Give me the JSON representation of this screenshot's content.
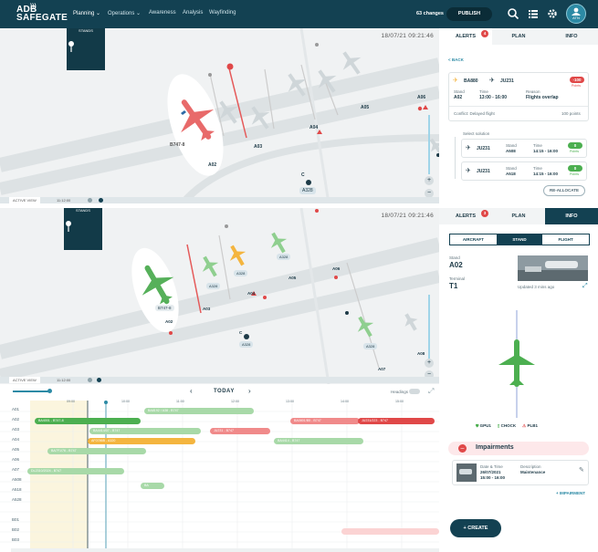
{
  "topbar": {
    "logo_line1": "ADB",
    "logo_line2": "SAFEGATE",
    "nav": [
      "Planning",
      "Operations",
      "Awareness",
      "Analysis",
      "Wayfinding"
    ],
    "changes": "63 changes",
    "publish": "PUBLISH",
    "user_initials": "ATN"
  },
  "map_top": {
    "timestamp": "18/07/21  09:21:46",
    "stands_label": "STANDS",
    "strip_label": "ACTIVE VIEW",
    "strip_time": "11:12:00",
    "labels": {
      "aircraft": "B747-8",
      "a02": "A02",
      "a03": "A03",
      "a04": "A04",
      "a05": "A05",
      "a06": "A06",
      "c": "C",
      "a328": "A328"
    }
  },
  "map_bottom": {
    "timestamp": "18/07/21  09:21:46",
    "stands_label": "STANDS",
    "strip_label": "ACTIVE VIEW",
    "strip_time": "11:12:00",
    "labels": {
      "aircraft": "B747-8",
      "a02": "A02",
      "a03": "A03",
      "a04": "A04",
      "a05": "A05",
      "a06": "A06",
      "a07": "A07",
      "a08": "A08",
      "c": "C",
      "a328_1": "A328",
      "a328_2": "A328",
      "a328_3": "A328",
      "a328_4": "A328",
      "a328_5": "A328"
    }
  },
  "timeline": {
    "today": "TODAY",
    "headings": "Headings",
    "rows": [
      "A01",
      "A02",
      "A03",
      "A04",
      "A05",
      "A06",
      "A07",
      "A508",
      "A518",
      "A528",
      "",
      "B01",
      "B02",
      "B03"
    ],
    "times": [
      "09:00",
      "10:00",
      "11:00",
      "12:00",
      "13:00",
      "14:00",
      "15:00",
      "16:00"
    ],
    "bars": [
      {
        "label": "BA8192 / A38 - B747",
        "color": "#8fcf8f"
      },
      {
        "label": "BA4001 - B747-8",
        "color": "#4caf50"
      },
      {
        "label": "BA0801/B5 - B747",
        "color": "#f08a8a"
      },
      {
        "label": "JU231/223 - B747",
        "color": "#e04848"
      },
      {
        "label": "BA4414/07 - B747",
        "color": "#8fcf8f"
      },
      {
        "label": "JU231 - B747",
        "color": "#f08a8a"
      },
      {
        "label": "AF0786B - A320",
        "color": "#f4b53f"
      },
      {
        "label": "BA4414 - B747",
        "color": "#8fcf8f"
      },
      {
        "label": "BA7F1/76 - B747",
        "color": "#8fcf8f"
      },
      {
        "label": "DL2310/2024 - B747",
        "color": "#8fcf8f"
      },
      {
        "label": "BA",
        "color": "#8fcf8f"
      }
    ]
  },
  "alerts_panel": {
    "tabs": [
      "ALERTS",
      "PLAN",
      "INFO"
    ],
    "alert_count": "4",
    "back": "< BACK",
    "flight_a": "BA880",
    "flight_b": "JU231",
    "points_badge": "-100",
    "points_label": "Points",
    "stand_label": "Stand",
    "stand_value": "A02",
    "time_label": "Time",
    "time_value": "13:00 - 16:00",
    "reason_label": "Reason",
    "reason_value": "Flights overlap",
    "conflict": "Conflict: Delayed flight",
    "conflict_points": "100 points",
    "select_solution": "Select solution",
    "solutions": [
      {
        "flight": "JU231",
        "stand_label": "Stand",
        "stand": "A508",
        "time_label": "Time",
        "time": "14:15 - 16:00",
        "score": "0",
        "score_label": "Points"
      },
      {
        "flight": "JU231",
        "stand_label": "Stand",
        "stand": "A518",
        "time_label": "Time",
        "time": "14:15 - 16:00",
        "score": "0",
        "score_label": "Points"
      }
    ],
    "reallocate": "RE-ALLOCATE"
  },
  "info_panel": {
    "tabs": [
      "ALERTS",
      "PLAN",
      "INFO"
    ],
    "alert_count": "3",
    "segments": [
      "AIRCRAFT",
      "STAND",
      "FLIGHT"
    ],
    "stand_label": "Stand",
    "stand_value": "A02",
    "terminal_label": "Terminal",
    "terminal_value": "T1",
    "updated": "Updated 3 mins ago",
    "status": [
      "GPU1",
      "CHOCK",
      "PLB1"
    ],
    "impairments_title": "Impairments",
    "date_label": "Date & Time",
    "date_value": "26/07/2021",
    "date_time": "15:00 - 16:00",
    "desc_label": "Description",
    "desc_value": "Maintenance",
    "add_impairment": "+ IMPAIRMENT",
    "create": "+ CREATE"
  },
  "colors": {
    "navy": "#134152",
    "alert_red": "#e04848",
    "ok_green": "#4caf50",
    "amber": "#f4b53f"
  }
}
